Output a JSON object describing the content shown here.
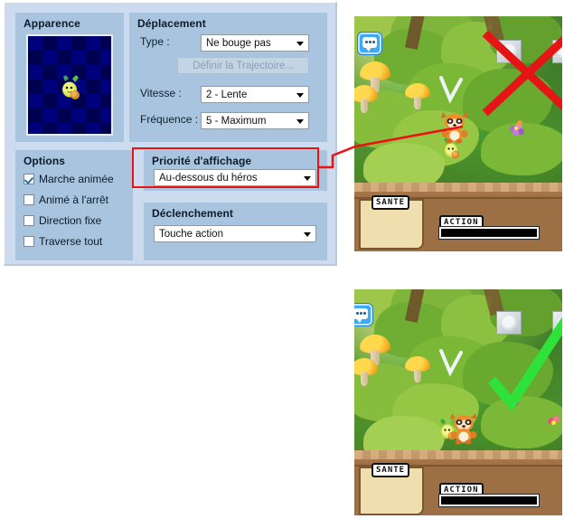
{
  "editor": {
    "groups": {
      "apparence": {
        "title": "Apparence"
      },
      "deplacement": {
        "title": "Déplacement",
        "type_label": "Type :",
        "type_value": "Ne bouge pas",
        "trajectory_button": "Définir la Trajectoire...",
        "vitesse_label": "Vitesse :",
        "vitesse_value": "2 - Lente",
        "frequence_label": "Fréquence :",
        "frequence_value": "5 - Maximum"
      },
      "options": {
        "title": "Options",
        "items": [
          {
            "label": "Marche animée",
            "checked": true
          },
          {
            "label": "Animé à l'arrêt",
            "checked": false
          },
          {
            "label": "Direction fixe",
            "checked": false
          },
          {
            "label": "Traverse tout",
            "checked": false
          }
        ]
      },
      "priorite": {
        "title": "Priorité d'affichage",
        "value": "Au-dessous du héros"
      },
      "declenchement": {
        "title": "Déclenchement",
        "value": "Touche action"
      }
    }
  },
  "screenshots": [
    {
      "name": "before",
      "hud": {
        "health_label": "SANTE",
        "action_label": "ACTION"
      },
      "overlay_mark": "cross",
      "overlay_color": "#e61515"
    },
    {
      "name": "after",
      "hud": {
        "health_label": "SANTE",
        "action_label": "ACTION"
      },
      "overlay_mark": "check",
      "overlay_color": "#2fe23a"
    }
  ],
  "annotation": {
    "line_color": "#ee1111",
    "highlight_color": "#ee1111"
  }
}
